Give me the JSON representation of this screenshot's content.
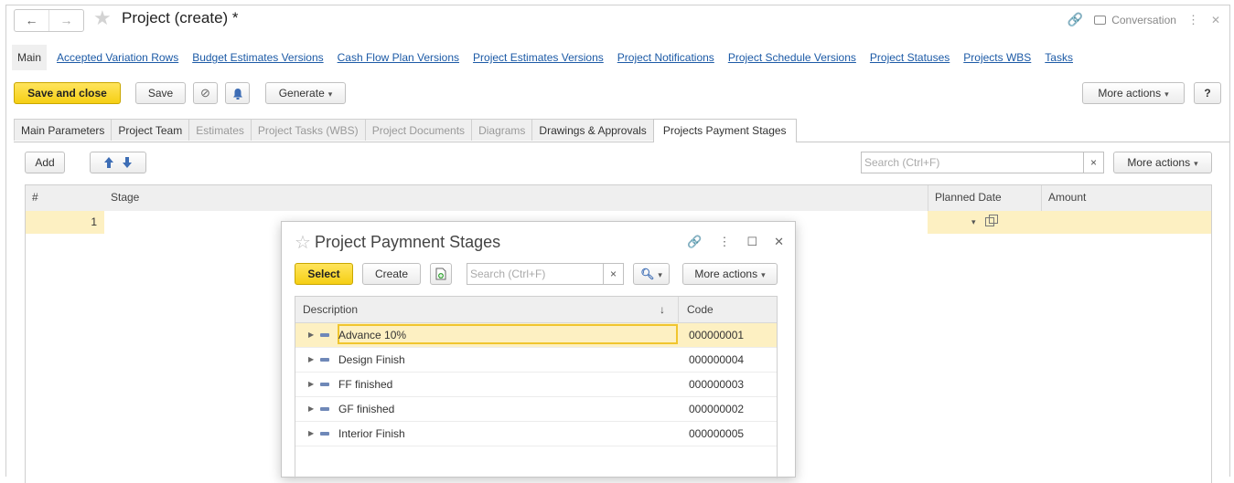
{
  "window": {
    "title": "Project (create) *",
    "back_symbol": "←",
    "forward_symbol": "→",
    "conversation_label": "Conversation"
  },
  "navlinks": {
    "active": "Main",
    "links": [
      "Accepted Variation Rows",
      "Budget Estimates Versions",
      "Cash Flow Plan Versions",
      "Project Estimates Versions",
      "Project Notifications",
      "Project Schedule Versions",
      "Project Statuses",
      "Projects WBS",
      "Tasks"
    ]
  },
  "toolbar": {
    "save_and_close": "Save and close",
    "save": "Save",
    "generate": "Generate",
    "more_actions": "More actions",
    "help": "?"
  },
  "tabs": [
    {
      "label": "Main Parameters",
      "state": "normal"
    },
    {
      "label": "Project Team",
      "state": "normal"
    },
    {
      "label": "Estimates",
      "state": "disabled"
    },
    {
      "label": "Project Tasks (WBS)",
      "state": "disabled"
    },
    {
      "label": "Project Documents",
      "state": "disabled"
    },
    {
      "label": "Diagrams",
      "state": "disabled"
    },
    {
      "label": "Drawings & Approvals",
      "state": "normal"
    },
    {
      "label": "Projects Payment Stages",
      "state": "selected"
    }
  ],
  "table_toolbar": {
    "add": "Add",
    "search_placeholder": "Search (Ctrl+F)",
    "clear": "×",
    "more_actions": "More actions"
  },
  "table": {
    "columns": [
      "#",
      "Stage",
      "Planned Date",
      "Amount"
    ],
    "rows": [
      {
        "num": "1",
        "stage": "",
        "planned_date": "",
        "amount": ""
      }
    ]
  },
  "popup": {
    "title": "Project Paymnent Stages",
    "select": "Select",
    "create": "Create",
    "search_placeholder": "Search (Ctrl+F)",
    "clear": "×",
    "more_actions": "More actions",
    "columns": {
      "description": "Description",
      "sort_indicator": "↓",
      "code": "Code"
    },
    "rows": [
      {
        "description": "Advance 10%",
        "code": "000000001"
      },
      {
        "description": "Design Finish",
        "code": "000000004"
      },
      {
        "description": "FF finished",
        "code": "000000003"
      },
      {
        "description": "GF finished",
        "code": "000000002"
      },
      {
        "description": "Interior Finish",
        "code": "000000005"
      }
    ]
  },
  "colors": {
    "primary_button": "#f5cf14",
    "selected_row": "#fdf0c2",
    "link": "#1c5aa6"
  }
}
